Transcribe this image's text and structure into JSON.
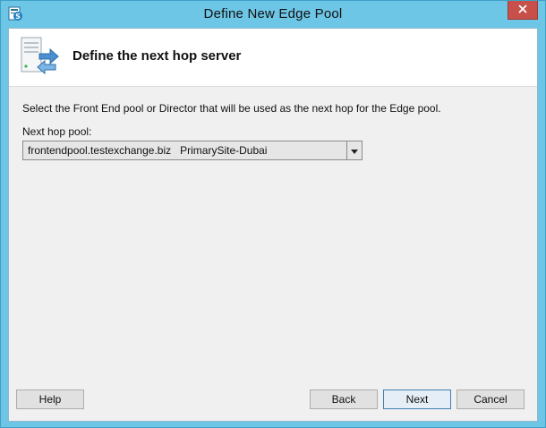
{
  "window": {
    "title": "Define New Edge Pool",
    "accent_color": "#6ec6e6",
    "close_color": "#c7504b"
  },
  "header": {
    "title": "Define the next hop server",
    "icon": "server-arrow-icon"
  },
  "main": {
    "description": "Select the Front End pool or Director that will be used as the next hop for the Edge pool.",
    "next_hop_label": "Next hop pool:",
    "next_hop_value": "frontendpool.testexchange.biz   PrimarySite-Dubai"
  },
  "buttons": {
    "help": "Help",
    "back": "Back",
    "next": "Next",
    "cancel": "Cancel"
  }
}
